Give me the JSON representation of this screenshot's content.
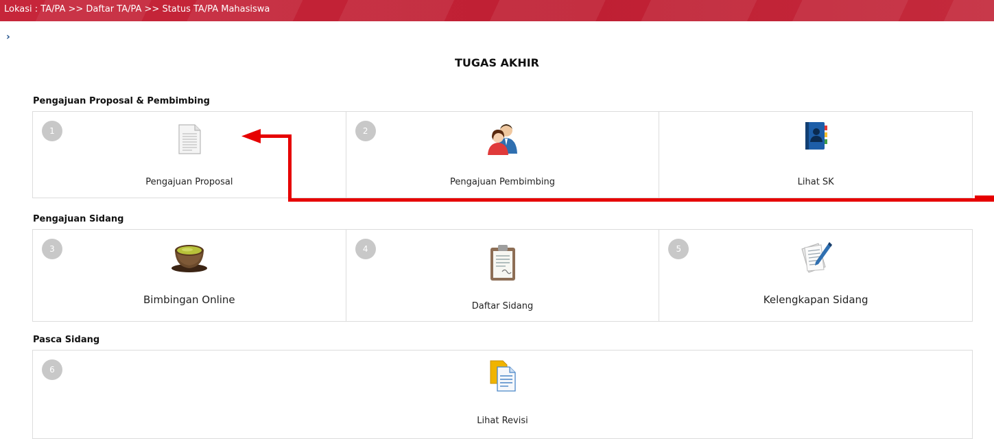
{
  "breadcrumb": "Lokasi : TA/PA >> Daftar TA/PA >> Status TA/PA Mahasiswa",
  "toggle_glyph": "›",
  "page_title": "TUGAS AKHIR",
  "sections": [
    {
      "title": "Pengajuan Proposal & Pembimbing",
      "cards": [
        {
          "number": "1",
          "label": "Pengajuan Proposal",
          "icon": "document-icon"
        },
        {
          "number": "2",
          "label": "Pengajuan Pembimbing",
          "icon": "users-icon"
        },
        {
          "number": "",
          "label": "Lihat SK",
          "icon": "address-book-icon"
        }
      ]
    },
    {
      "title": "Pengajuan Sidang",
      "cards": [
        {
          "number": "3",
          "label": "Bimbingan Online",
          "icon": "tea-cup-icon"
        },
        {
          "number": "4",
          "label": "Daftar Sidang",
          "icon": "clipboard-icon"
        },
        {
          "number": "5",
          "label": "Kelengkapan Sidang",
          "icon": "document-pen-icon"
        }
      ]
    },
    {
      "title": "Pasca Sidang",
      "cards": [
        {
          "number": "6",
          "label": "Lihat Revisi",
          "icon": "documents-copy-icon"
        }
      ]
    }
  ],
  "colors": {
    "topbar": "#c6263a",
    "badge": "#c8c8c8",
    "annotation_arrow": "#e60000"
  }
}
